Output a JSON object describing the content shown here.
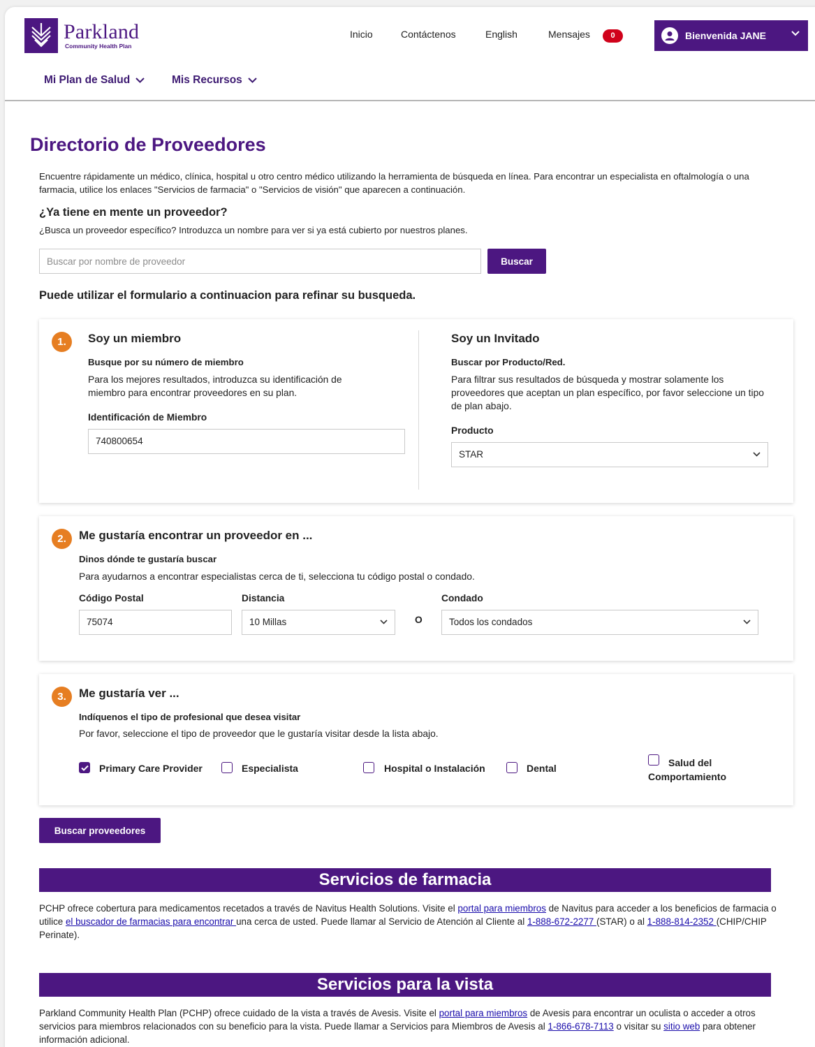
{
  "brand": {
    "name": "Parkland",
    "sub": "Community Health Plan",
    "color": "#4c1781"
  },
  "nav": {
    "home": "Inicio",
    "contact": "Contáctenos",
    "language": "English",
    "messages": "Mensajes",
    "message_count": "0",
    "welcome": "Bienvenida JANE"
  },
  "menu": {
    "plan": "Mi Plan de Salud",
    "resources": "Mis Recursos"
  },
  "page": {
    "title": "Directorio de Proveedores",
    "intro": "Encuentre rápidamente un médico, clínica, hospital u otro centro médico utilizando la herramienta de búsqueda en línea. Para encontrar un especialista en oftalmología o una farmacia, utilice los enlaces \"Servicios de farmacia\" o \"Servicios de visión\" que aparecen a continuación.",
    "provider_question": "¿Ya tiene en mente un proveedor?",
    "provider_question_desc": "¿Busca un proveedor específico? Introduzca un nombre para ver si ya está cubierto por nuestros planes.",
    "search_placeholder": "Buscar por nombre de proveedor",
    "search_button": "Buscar",
    "refine": "Puede utilizar el formulario a continuacion para refinar su busqueda."
  },
  "step1": {
    "number": "1.",
    "member_title": "Soy un miembro",
    "member_subtitle": "Busque por su número de miembro",
    "member_desc": "Para los mejores resultados, introduzca su identificación de miembro para encontrar proveedores en su plan.",
    "member_id_label": "Identificación de Miembro",
    "member_id_value": "740800654",
    "guest_title": "Soy un Invitado",
    "guest_subtitle": "Buscar por Producto/Red.",
    "guest_desc": "Para filtrar sus resultados de búsqueda y mostrar solamente los proveedores que aceptan un plan específico, por favor seleccione un tipo de plan abajo.",
    "product_label": "Producto",
    "product_value": "STAR"
  },
  "step2": {
    "number": "2.",
    "title": "Me gustaría encontrar un proveedor en ...",
    "subtitle": "Dinos dónde te gustaría buscar",
    "desc": "Para ayudarnos a encontrar especialistas cerca de ti, selecciona tu código postal o condado.",
    "zip_label": "Código Postal",
    "zip_value": "75074",
    "distance_label": "Distancia",
    "distance_value": "10 Millas",
    "or": "O",
    "county_label": "Condado",
    "county_value": "Todos los condados"
  },
  "step3": {
    "number": "3.",
    "title": "Me gustaría ver ...",
    "subtitle": "Indíquenos el tipo de profesional que desea visitar",
    "desc": "Por favor, seleccione el tipo de proveedor que le gustaría visitar desde la lista abajo.",
    "options": [
      {
        "label": "Primary Care Provider",
        "checked": true
      },
      {
        "label": "Especialista",
        "checked": false
      },
      {
        "label": "Hospital o Instalación",
        "checked": false
      },
      {
        "label": "Dental",
        "checked": false
      },
      {
        "label": "Salud del Comportamiento",
        "checked": false
      }
    ]
  },
  "search_providers_button": "Buscar proveedores",
  "pharmacy": {
    "title": "Servicios de farmacia",
    "t1": "PCHP ofrece cobertura para medicamentos recetados a través de Navitus Health Solutions. Visite el ",
    "link1": "portal para miembros",
    "t2": " de Navitus para acceder a los beneficios de farmacia o utilice ",
    "link2": "el buscador de farmacias para encontrar ",
    "t3": "una cerca de usted. Puede llamar al Servicio de Atención al Cliente al ",
    "link3": "1-888-672-2277 ",
    "t4": "(STAR) o al ",
    "link4": "1-888-814-2352 ",
    "t5": "(CHIP/CHIP Perinate)."
  },
  "vision": {
    "title": "Servicios para la vista",
    "t1": "Parkland Community Health Plan (PCHP) ofrece cuidado de la vista a través de Avesis. Visite el ",
    "link1": "portal para miembros",
    "t2": " de Avesis para encontrar un oculista o acceder a otros servicios para miembros relacionados con su beneficio para la vista. Puede llamar a Servicios para Miembros de Avesis al ",
    "link2": "1-866-678-7113",
    "t3": " o visitar su ",
    "link3": "sitio web",
    "t4": " para obtener información adicional."
  }
}
